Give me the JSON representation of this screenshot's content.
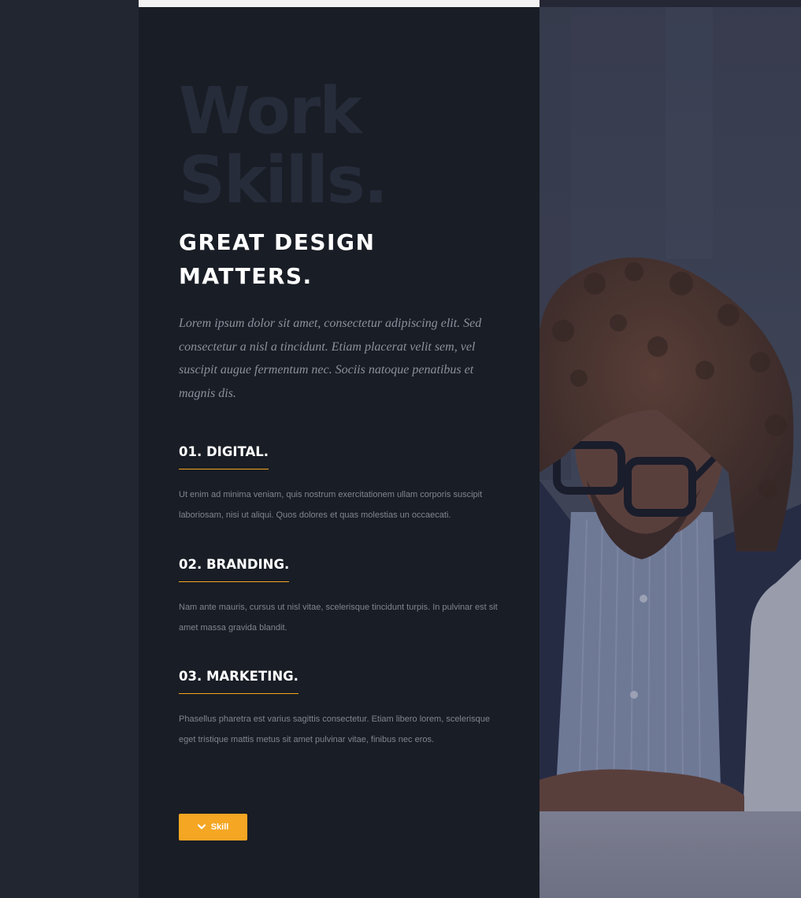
{
  "hero": {
    "title_line1": "Work",
    "title_line2": "Skills.",
    "subtitle_line1": "GREAT DESIGN",
    "subtitle_line2": "MATTERS.",
    "intro": "Lorem ipsum dolor sit amet, consectetur adipiscing elit. Sed consectetur a nisl a tincidunt. Etiam placerat velit sem, vel suscipit augue fermentum nec. Sociis natoque penatibus et magnis dis."
  },
  "skills": [
    {
      "number": "01.",
      "name": "DIGITAL.",
      "description": "Ut enim ad minima veniam, quis nostrum exercitationem ullam corporis suscipit laboriosam, nisi ut aliqui. Quos dolores et quas molestias un occaecati."
    },
    {
      "number": "02.",
      "name": "BRANDING.",
      "description": "Nam ante mauris, cursus ut nisl vitae, scelerisque tincidunt turpis. In pulvinar est sit amet massa gravida blandit."
    },
    {
      "number": "03.",
      "name": "MARKETING.",
      "description": "Phasellus pharetra est varius sagittis consectetur. Etiam libero lorem, scelerisque eget tristique mattis metus sit amet pulvinar vitae, finibus nec eros."
    }
  ],
  "button": {
    "label": "Skill",
    "icon": "chevron-down-icon"
  },
  "colors": {
    "accent": "#f5a623",
    "panel": "#191d25",
    "gutter": "#212631",
    "ghost_title": "#272c3b"
  }
}
